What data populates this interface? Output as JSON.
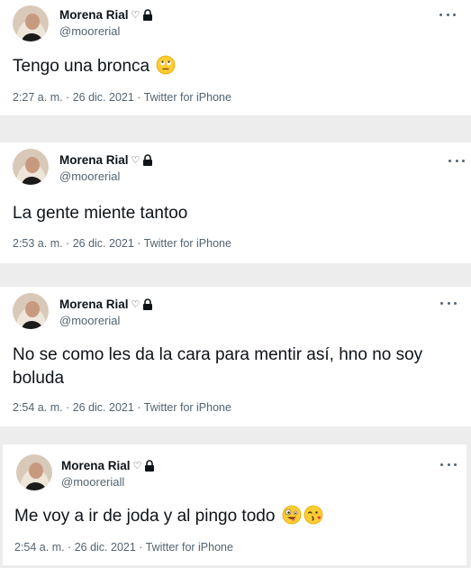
{
  "tweets": [
    {
      "name": "Morena Rial",
      "heart": "♡",
      "handle": "@moorerial",
      "text": "Tengo una bronca",
      "emojis": [
        "eyeroll-emoji"
      ],
      "time": "2:27 a. m. · 26 dic. 2021 · Twitter for iPhone"
    },
    {
      "name": "Morena Rial",
      "heart": "♡",
      "handle": "@moorerial",
      "text": "La gente miente tantoo",
      "emojis": [],
      "time": "2:53 a. m. · 26 dic. 2021 · Twitter for iPhone"
    },
    {
      "name": "Morena Rial",
      "heart": "♡",
      "handle": "@moorerial",
      "text": "No se como les da la cara para mentir así, hno no soy boluda",
      "emojis": [],
      "time": "2:54 a. m. · 26 dic. 2021 · Twitter for iPhone"
    },
    {
      "name": "Morena Rial",
      "heart": "♡",
      "handle": "@mooreriall",
      "text": "Me voy a ir de joda y al pingo todo",
      "emojis": [
        "zany-face-emoji",
        "kissing-face-emoji"
      ],
      "time": "2:54 a. m. · 26 dic. 2021 · Twitter for iPhone"
    }
  ]
}
